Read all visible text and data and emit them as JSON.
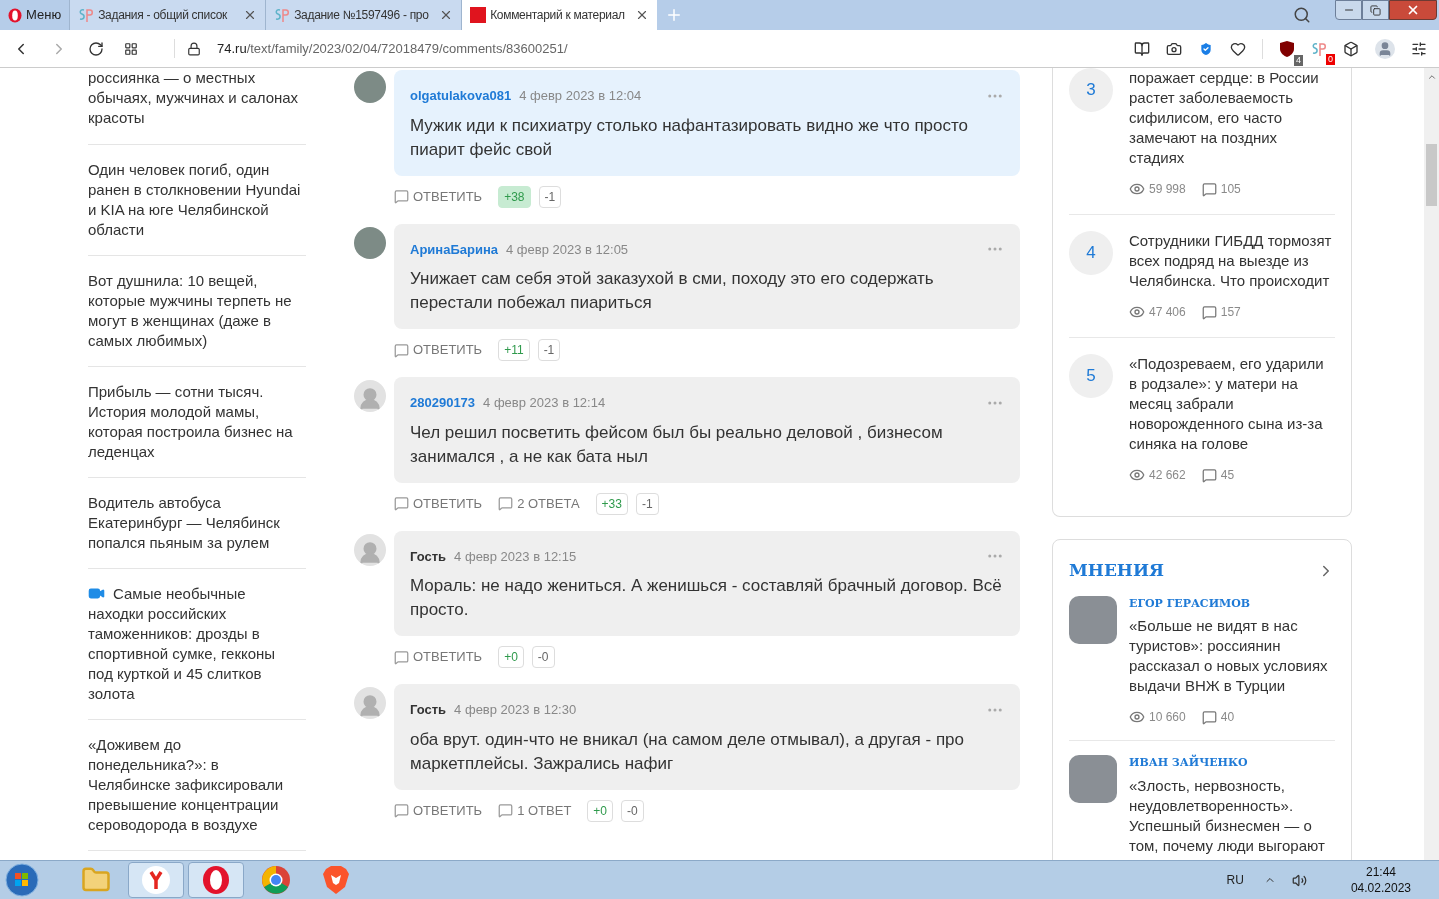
{
  "browser": {
    "menu_label": "Меню",
    "tabs": [
      {
        "kind": "sp",
        "title": "Задания - общий список",
        "selected": false
      },
      {
        "kind": "sp",
        "title": "Задание №1597496 - про",
        "selected": false
      },
      {
        "kind": "site",
        "title": "Комментарий к материал",
        "selected": true
      }
    ],
    "url_host": "74.ru",
    "url_path": "/text/family/2023/02/04/72018479/comments/83600251/",
    "extensions": [
      {
        "kind": "ublock",
        "badge": "4"
      },
      {
        "kind": "sp",
        "badge": "0"
      }
    ]
  },
  "left_news": [
    {
      "kind": "text",
      "title": "россиянка — о местных обычаях, мужчинах и салонах красоты"
    },
    {
      "kind": "text",
      "title": "Один человек погиб, один ранен в столкновении Hyundai и KIA на юге Челябинской области"
    },
    {
      "kind": "text",
      "title": "Вот душнила: 10 вещей, которые мужчины терпеть не могут в женщинах (даже в самых любимых)"
    },
    {
      "kind": "text",
      "title": "Прибыль — сотни тысяч. История молодой мамы, которая построила бизнес на леденцах"
    },
    {
      "kind": "text",
      "title": "Водитель автобуса Екатеринбург — Челябинск попался пьяным за рулем"
    },
    {
      "kind": "video",
      "title": "Самые необычные находки российских таможенников: дрозды в спортивной сумке, гекконы под курткой и 45 слитков золота"
    },
    {
      "kind": "text",
      "title": "«Доживем до понедельника?»: в Челябинске зафиксировали превышение концентрации сероводорода в воздухе"
    }
  ],
  "comments": [
    {
      "has_photo": true,
      "author": "olgatulakova081",
      "guest": false,
      "date": "4 февр 2023 в 12:04",
      "text": "Мужик иди к психиатру столько нафантазировать видно же что просто пиарит фейс свой",
      "highlighted": true,
      "reply": "ОТВЕТИТЬ",
      "up": "+38",
      "up_active": true,
      "down": "-1"
    },
    {
      "has_photo": true,
      "author": "АринаБарина",
      "guest": false,
      "date": "4 февр 2023 в 12:05",
      "text": "Унижает сам себя этой заказухой в сми, походу это его содержать перестали побежал пиариться",
      "highlighted": false,
      "reply": "ОТВЕТИТЬ",
      "up": "+11",
      "up_active": false,
      "down": "-1"
    },
    {
      "has_photo": false,
      "author": "280290173",
      "guest": false,
      "date": "4 февр 2023 в 12:14",
      "text": "Чел решил посветить фейсом был бы реально деловой , бизнесом занимался , а не как бата ныл",
      "highlighted": false,
      "reply": "ОТВЕТИТЬ",
      "replies": "2 ОТВЕТА",
      "up": "+33",
      "up_active": false,
      "down": "-1"
    },
    {
      "has_photo": false,
      "author": "Гость",
      "guest": true,
      "date": "4 февр 2023 в 12:15",
      "text": "Мораль: не надо жениться. А женишься - составляй брачный договор. Всё просто.",
      "highlighted": false,
      "reply": "ОТВЕТИТЬ",
      "up": "+0",
      "up_active": false,
      "down": "-0"
    },
    {
      "has_photo": false,
      "author": "Гость",
      "guest": true,
      "date": "4 февр 2023 в 12:30",
      "text": "оба врут. один-что не вникал (на самом деле отмывал), а другая - про маркетплейсы. Зажрались нафиг",
      "highlighted": false,
      "reply": "ОТВЕТИТЬ",
      "replies": "1 ОТВЕТ",
      "up": "+0",
      "up_active": false,
      "down": "-0"
    }
  ],
  "top_news": [
    {
      "rank": "3",
      "title": "поражает сердце: в России растет заболеваемость сифилисом, его часто замечают на поздних стадиях",
      "views": "59 998",
      "comments": "105"
    },
    {
      "rank": "4",
      "title": "Сотрудники ГИБДД тормозят всех подряд на выезде из Челябинска. Что происходит",
      "views": "47 406",
      "comments": "157"
    },
    {
      "rank": "5",
      "title": "«Подозреваем, его ударили в родзале»: у матери на месяц забрали новорожденного сына из-за синяка на голове",
      "views": "42 662",
      "comments": "45"
    }
  ],
  "opinions": {
    "title": "МНЕНИЯ",
    "items": [
      {
        "author": "ЕГОР ГЕРАСИМОВ",
        "title": "«Больше не видят в нас туристов»: россиянин рассказал о новых условиях выдачи ВНЖ в Турции",
        "views": "10 660",
        "comments": "40"
      },
      {
        "author": "ИВАН ЗАЙЧЕНКО",
        "title": "«Злость, нервозность, неудовлетворенность». Успешный бизнесмен — о том, почему люди выгорают"
      }
    ]
  },
  "taskbar": {
    "apps": [
      {
        "kind": "folder",
        "open": false
      },
      {
        "kind": "yandex",
        "open": true
      },
      {
        "kind": "opera",
        "open": true
      },
      {
        "kind": "chrome",
        "open": false
      },
      {
        "kind": "brave",
        "open": false
      }
    ],
    "language": "RU",
    "time": "21:44",
    "date": "04.02.2023"
  }
}
